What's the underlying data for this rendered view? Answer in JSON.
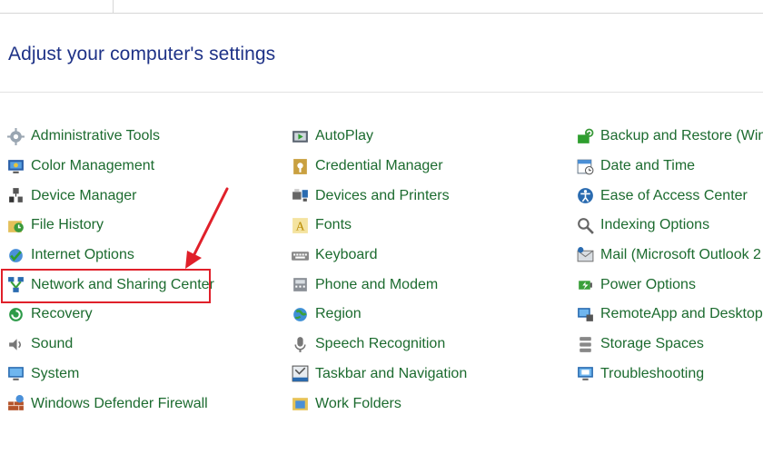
{
  "header": {
    "title": "Adjust your computer's settings"
  },
  "columns": [
    {
      "items": [
        {
          "label": "Administrative Tools",
          "icon": "admin-tools-icon"
        },
        {
          "label": "Color Management",
          "icon": "color-management-icon"
        },
        {
          "label": "Device Manager",
          "icon": "device-manager-icon"
        },
        {
          "label": "File History",
          "icon": "file-history-icon"
        },
        {
          "label": "Internet Options",
          "icon": "internet-options-icon"
        },
        {
          "label": "Network and Sharing Center",
          "icon": "network-icon"
        },
        {
          "label": "Recovery",
          "icon": "recovery-icon"
        },
        {
          "label": "Sound",
          "icon": "sound-icon"
        },
        {
          "label": "System",
          "icon": "system-icon"
        },
        {
          "label": "Windows Defender Firewall",
          "icon": "firewall-icon"
        }
      ]
    },
    {
      "items": [
        {
          "label": "AutoPlay",
          "icon": "autoplay-icon"
        },
        {
          "label": "Credential Manager",
          "icon": "credential-manager-icon"
        },
        {
          "label": "Devices and Printers",
          "icon": "devices-printers-icon"
        },
        {
          "label": "Fonts",
          "icon": "fonts-icon"
        },
        {
          "label": "Keyboard",
          "icon": "keyboard-icon"
        },
        {
          "label": "Phone and Modem",
          "icon": "phone-modem-icon"
        },
        {
          "label": "Region",
          "icon": "region-icon"
        },
        {
          "label": "Speech Recognition",
          "icon": "microphone-icon"
        },
        {
          "label": "Taskbar and Navigation",
          "icon": "taskbar-icon"
        },
        {
          "label": "Work Folders",
          "icon": "work-folders-icon"
        }
      ]
    },
    {
      "items": [
        {
          "label": "Backup and Restore (Wind",
          "icon": "backup-restore-icon"
        },
        {
          "label": "Date and Time",
          "icon": "date-time-icon"
        },
        {
          "label": "Ease of Access Center",
          "icon": "ease-of-access-icon"
        },
        {
          "label": "Indexing Options",
          "icon": "indexing-icon"
        },
        {
          "label": "Mail (Microsoft Outlook 2",
          "icon": "mail-icon"
        },
        {
          "label": "Power Options",
          "icon": "power-options-icon"
        },
        {
          "label": "RemoteApp and Desktop",
          "icon": "remoteapp-icon"
        },
        {
          "label": "Storage Spaces",
          "icon": "storage-spaces-icon"
        },
        {
          "label": "Troubleshooting",
          "icon": "troubleshooting-icon"
        }
      ]
    }
  ],
  "colors": {
    "link": "#1c6b2f",
    "heading": "#1e3287",
    "annotation": "#e0202a"
  }
}
